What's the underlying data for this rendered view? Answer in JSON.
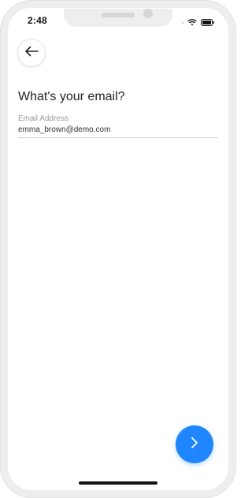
{
  "status_bar": {
    "time": "2:48",
    "icons": [
      "dot-icon",
      "wifi-icon",
      "battery-icon"
    ]
  },
  "header": {
    "back_icon": "arrow-left-icon"
  },
  "main": {
    "title": "What's your email?",
    "email_field": {
      "label": "Email Address",
      "value": "emma_brown@demo.com"
    }
  },
  "footer": {
    "next_icon": "chevron-right-icon",
    "accent_color": "#1f86ff"
  }
}
